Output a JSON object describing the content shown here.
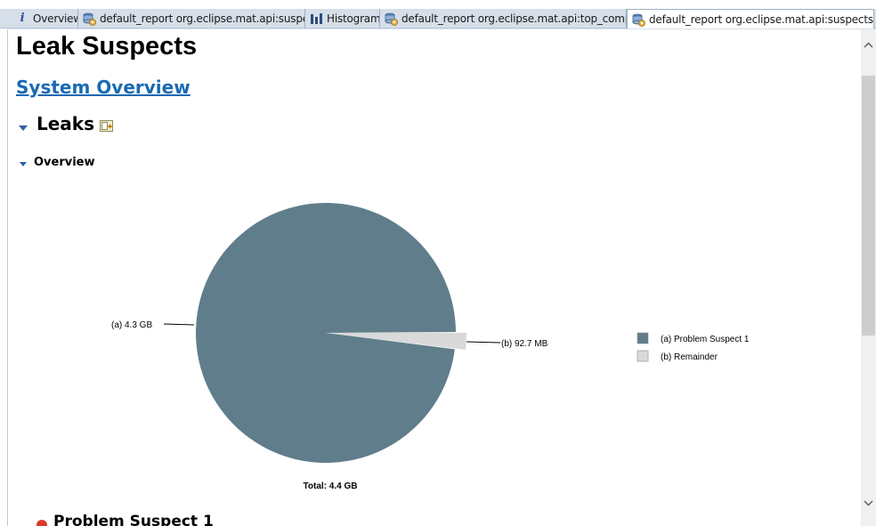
{
  "tabs": [
    {
      "label": "Overview",
      "icon": "info-icon"
    },
    {
      "label": "default_report  org.eclipse.mat.api:suspects",
      "icon": "report-icon"
    },
    {
      "label": "Histogram",
      "icon": "histogram-icon"
    },
    {
      "label": "default_report  org.eclipse.mat.api:top_comp...",
      "icon": "report-icon"
    },
    {
      "label": "default_report  org.eclipse.mat.api:suspects",
      "icon": "report-icon",
      "active": true
    }
  ],
  "page": {
    "title": "Leak Suspects",
    "system_overview_link": "System Overview",
    "leaks_heading": "Leaks",
    "overview_heading": "Overview",
    "problem_suspect_heading": "Problem Suspect 1"
  },
  "chart_data": {
    "type": "pie",
    "slices": [
      {
        "key": "(a)",
        "label": "(a)  4.3 GB",
        "legend": "(a)  Problem Suspect 1",
        "value": 4.3,
        "unit": "GB",
        "color": "#607d8b"
      },
      {
        "key": "(b)",
        "label": "(b)  92.7 MB",
        "legend": "(b)  Remainder",
        "value": 0.0927,
        "unit": "GB",
        "color": "#d9d9d9"
      }
    ],
    "total_label": "Total: 4.4 GB",
    "legend_placement": "right"
  },
  "colors": {
    "tab_strip": "#d6dfe9",
    "link": "#1a6ab3",
    "slice_a": "#607d8b",
    "slice_b": "#d9d9d9"
  }
}
